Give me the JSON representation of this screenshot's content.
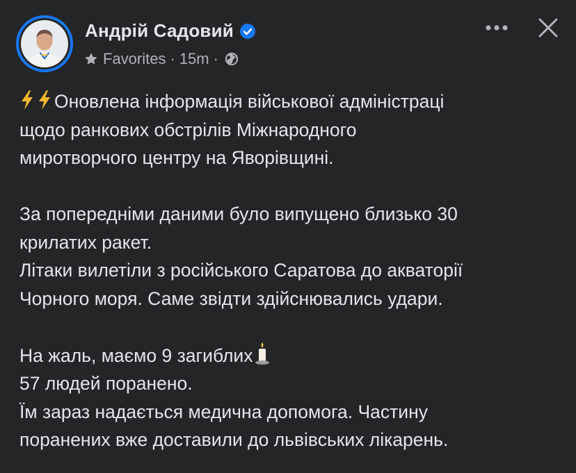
{
  "post_header": {
    "author_name": "Андрій Садовий",
    "verified_icon": "verified-badge-icon",
    "audience_label": "Favorites",
    "separator": "·",
    "time_ago": "15m",
    "privacy_icon": "globe-icon"
  },
  "actions": {
    "more_icon": "more-icon",
    "close_icon": "close-icon"
  },
  "post": {
    "paragraph1": {
      "emoji": "⚡⚡",
      "line1": "Оновлена інформація військової адміністраці",
      "line2": "щодо ранкових обстрілів Міжнародного",
      "line3": "миротворчого центру на Яворівщині."
    },
    "paragraph2": {
      "line1": "За попередніми даними було випущено близько 30",
      "line2": "крилатих ракет.",
      "line3": "Літаки вилетіли з російського Саратова до акваторії",
      "line4": "Чорного моря. Саме звідти здійснювались удари."
    },
    "paragraph3": {
      "line1": "На жаль, маємо 9 загиблих",
      "candle_emoji": "🕯️",
      "line2": "57 людей поранено.",
      "line3": "Їм зараз надається медична допомога. Частину",
      "line4": "поранених вже доставили до львівських лікарень."
    }
  },
  "colors": {
    "background": "#242526",
    "primary_text": "#e4e6eb",
    "secondary_text": "#b0b3b8",
    "accent": "#1877f2"
  }
}
